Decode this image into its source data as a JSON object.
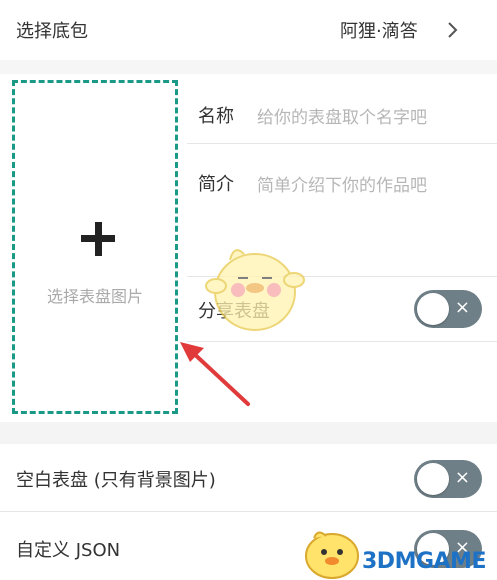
{
  "base_pack": {
    "label": "选择底包",
    "value": "阿狸·滴答"
  },
  "upload": {
    "label": "选择表盘图片"
  },
  "name_field": {
    "label": "名称",
    "placeholder": "给你的表盘取个名字吧"
  },
  "intro_field": {
    "label": "简介",
    "placeholder": "简单介绍下你的作品吧"
  },
  "share_row": {
    "label": "分享表盘",
    "toggle_on": false
  },
  "blank_row": {
    "label": "空白表盘 (只有背景图片)",
    "toggle_on": false
  },
  "json_row": {
    "label": "自定义 JSON",
    "toggle_on": false
  },
  "toggle_icon": "×",
  "watermark": {
    "text": "3DMGAME"
  },
  "colors": {
    "accent_dashed": "#1a9a86",
    "toggle_off": "#6f7f87",
    "arrow": "#e03a3a"
  }
}
